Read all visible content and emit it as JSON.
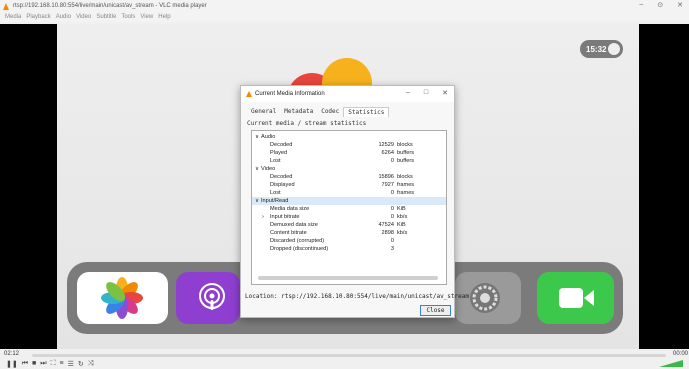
{
  "window": {
    "title": "rtsp://192.168.10.80:554/live/main/unicast/av_stream - VLC media player",
    "controls": [
      "–",
      "⊙",
      "✕"
    ]
  },
  "menu": [
    "Media",
    "Playback",
    "Audio",
    "Video",
    "Subtitle",
    "Tools",
    "View",
    "Help"
  ],
  "overlay": {
    "clock": "15:32"
  },
  "player": {
    "time_elapsed": "02:12",
    "time_total": "00:00"
  },
  "dialog": {
    "title": "Current Media Information",
    "controls": [
      "–",
      "□",
      "✕"
    ],
    "tabs": [
      "General",
      "Metadata",
      "Codec",
      "Statistics"
    ],
    "active_tab": "Statistics",
    "caption": "Current media / stream statistics",
    "stats": [
      {
        "label": "Audio",
        "value": "",
        "unit": "",
        "expander": "∨",
        "indent": 0
      },
      {
        "label": "Decoded",
        "value": "12529",
        "unit": "blocks",
        "expander": "",
        "indent": 2
      },
      {
        "label": "Played",
        "value": "6264",
        "unit": "buffers",
        "expander": "",
        "indent": 2
      },
      {
        "label": "Lost",
        "value": "0",
        "unit": "buffers",
        "expander": "",
        "indent": 2
      },
      {
        "label": "Video",
        "value": "",
        "unit": "",
        "expander": "∨",
        "indent": 0
      },
      {
        "label": "Decoded",
        "value": "15896",
        "unit": "blocks",
        "expander": "",
        "indent": 2
      },
      {
        "label": "Displayed",
        "value": "7927",
        "unit": "frames",
        "expander": "",
        "indent": 2
      },
      {
        "label": "Lost",
        "value": "0",
        "unit": "frames",
        "expander": "",
        "indent": 2
      },
      {
        "label": "Input/Read",
        "value": "",
        "unit": "",
        "expander": "∨",
        "indent": 0
      },
      {
        "label": "Media data size",
        "value": "0",
        "unit": "KiB",
        "expander": "",
        "indent": 2
      },
      {
        "label": "Input bitrate",
        "value": "0",
        "unit": "kb/s",
        "expander": "›",
        "indent": 1
      },
      {
        "label": "Demuxed data size",
        "value": "47524",
        "unit": "KiB",
        "expander": "",
        "indent": 2
      },
      {
        "label": "Content bitrate",
        "value": "2898",
        "unit": "kb/s",
        "expander": "",
        "indent": 2
      },
      {
        "label": "Discarded (corrupted)",
        "value": "0",
        "unit": "",
        "expander": "",
        "indent": 2
      },
      {
        "label": "Dropped (discontinued)",
        "value": "3",
        "unit": "",
        "expander": "",
        "indent": 2
      }
    ],
    "location": "Location: rtsp://192.168.10.80:554/live/main/unicast/av_stream",
    "close_label": "Close"
  },
  "colors": {
    "accent": "#f08a00",
    "selection": "#dbe8f7",
    "dock": "#7b7b7b",
    "facetime": "#3cc84a",
    "podcasts": "#8e3fcf"
  }
}
